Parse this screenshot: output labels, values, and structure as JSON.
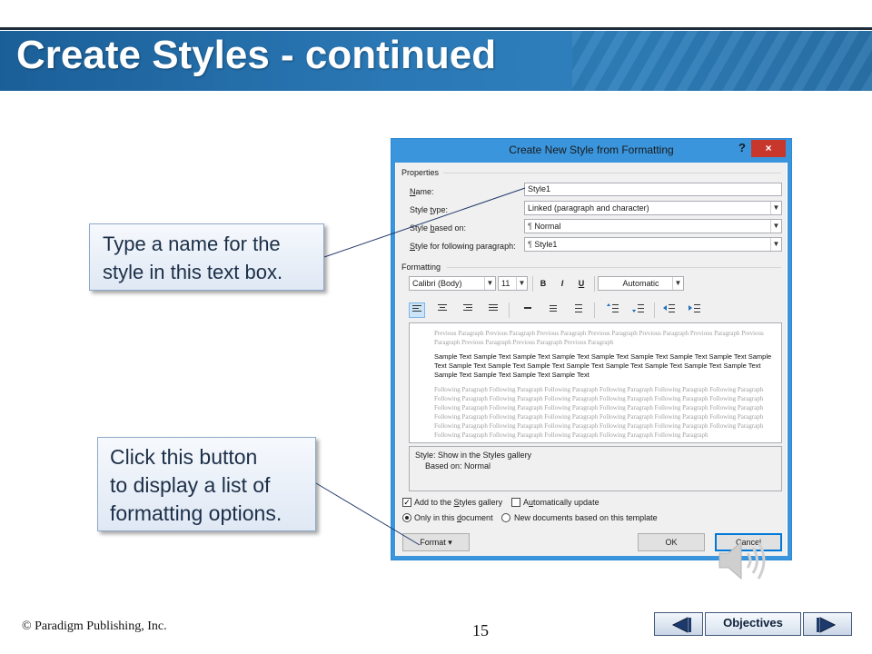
{
  "slide": {
    "title": "Create Styles - continued",
    "copyright": "© Paradigm Publishing, Inc.",
    "page_number": "15"
  },
  "callouts": {
    "name_box": [
      "Type a name for the",
      "style in this text box."
    ],
    "format_button": [
      "Click this button",
      "to display a list of",
      "formatting options."
    ]
  },
  "dialog": {
    "title": "Create New Style from Formatting",
    "help": "?",
    "close": "×",
    "properties_label": "Properties",
    "name": {
      "label_pre": "",
      "label_key": "N",
      "label_post": "ame:",
      "value": "Style1"
    },
    "style_type": {
      "label_pre": "Style ",
      "label_key": "t",
      "label_post": "ype:",
      "value": "Linked (paragraph and character)"
    },
    "style_based_on": {
      "label_pre": "Style ",
      "label_key": "b",
      "label_post": "ased on:",
      "value": "Normal"
    },
    "style_following": {
      "label_pre": "",
      "label_key": "S",
      "label_post": "tyle for following paragraph:",
      "value": "Style1"
    },
    "formatting_label": "Formatting",
    "font": "Calibri (Body)",
    "size": "11",
    "bold": "B",
    "italic": "I",
    "underline": "U",
    "color": "Automatic",
    "preview": {
      "previous": "Previous Paragraph Previous Paragraph Previous Paragraph Previous Paragraph Previous Paragraph Previous Paragraph Previous Paragraph Previous Paragraph Previous Paragraph Previous Paragraph",
      "sample": "Sample Text Sample Text Sample Text Sample Text Sample Text Sample Text Sample Text Sample Text Sample Text Sample Text Sample Text Sample Text Sample Text Sample Text Sample Text Sample Text Sample Text Sample Text Sample Text Sample Text Sample Text",
      "following": "Following Paragraph Following Paragraph Following Paragraph Following Paragraph Following Paragraph Following Paragraph Following Paragraph Following Paragraph Following Paragraph Following Paragraph Following Paragraph Following Paragraph Following Paragraph Following Paragraph Following Paragraph Following Paragraph Following Paragraph Following Paragraph Following Paragraph Following Paragraph Following Paragraph Following Paragraph Following Paragraph Following Paragraph Following Paragraph Following Paragraph Following Paragraph Following Paragraph Following Paragraph Following Paragraph Following Paragraph Following Paragraph Following Paragraph Following Paragraph Following Paragraph"
    },
    "description": {
      "line1": "Style: Show in the Styles gallery",
      "line2": "Based on: Normal"
    },
    "add_to_gallery": {
      "pre": "Add to the ",
      "key": "S",
      "post": "tyles gallery",
      "checked": true
    },
    "auto_update": {
      "pre": "A",
      "key": "u",
      "post": "tomatically update",
      "checked": false
    },
    "only_this_doc": {
      "pre": "Only in this ",
      "key": "d",
      "post": "ocument",
      "selected": true
    },
    "new_docs": {
      "label": "New documents based on this template",
      "selected": false
    },
    "format_button": "Format ▾",
    "ok_button": "OK",
    "cancel_button": "Cancel"
  },
  "nav": {
    "objectives": "Objectives"
  }
}
